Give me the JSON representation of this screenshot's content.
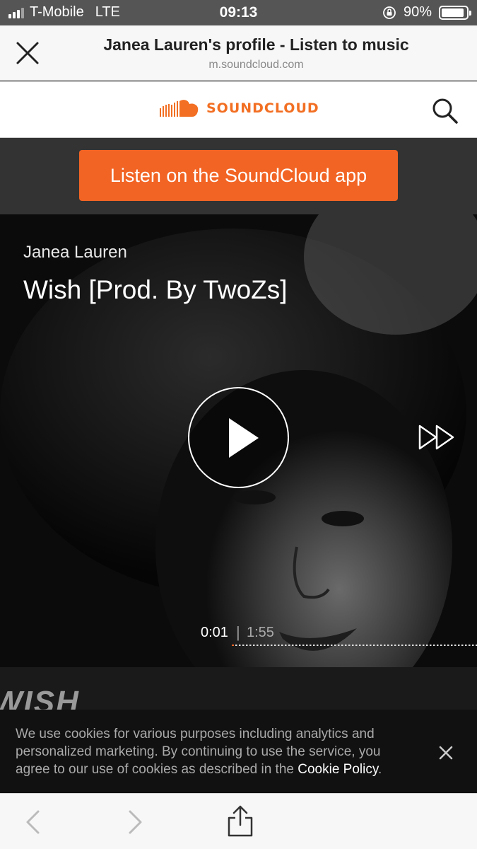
{
  "status_bar": {
    "carrier": "T-Mobile",
    "network": "LTE",
    "time": "09:13",
    "battery_percent": "90%",
    "battery_level": 0.9
  },
  "browser": {
    "title": "Janea Lauren's profile - Listen to music",
    "url": "m.soundcloud.com"
  },
  "soundcloud": {
    "logo_text": "SOUNDCLOUD",
    "brand_color": "#f26f23",
    "app_button_label": "Listen on the SoundCloud app"
  },
  "player": {
    "artist": "Janea Lauren",
    "title": "Wish [Prod. By TwoZs]",
    "current_time": "0:01",
    "separator": "|",
    "duration": "1:55",
    "progress": 0.009,
    "artwork_text": "WISH"
  },
  "cookie_notice": {
    "text": "We use cookies for various purposes including analytics and personalized marketing. By continuing to use the service, you agree to our use of cookies as described in the ",
    "link_text": "Cookie Policy",
    "suffix": "."
  },
  "icons": {
    "close": "close-icon",
    "search": "search-icon",
    "play": "play-icon",
    "skip": "skip-forward-icon",
    "back": "chevron-left-icon",
    "forward": "chevron-right-icon",
    "share": "share-icon"
  }
}
